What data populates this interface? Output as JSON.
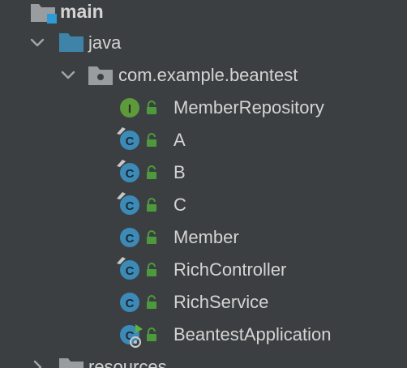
{
  "tree": {
    "main": {
      "label": "main"
    },
    "java": {
      "label": "java"
    },
    "package": {
      "label": "com.example.beantest"
    },
    "classes": [
      {
        "label": "MemberRepository",
        "kind": "interface",
        "letter": "I",
        "icon": "interface-icon",
        "has_tag": false
      },
      {
        "label": "A",
        "kind": "class",
        "letter": "C",
        "icon": "class-icon",
        "has_tag": true
      },
      {
        "label": "B",
        "kind": "class",
        "letter": "C",
        "icon": "class-icon",
        "has_tag": true
      },
      {
        "label": "C",
        "kind": "class",
        "letter": "C",
        "icon": "class-icon",
        "has_tag": true
      },
      {
        "label": "Member",
        "kind": "class",
        "letter": "C",
        "icon": "class-icon",
        "has_tag": false
      },
      {
        "label": "RichController",
        "kind": "class",
        "letter": "C",
        "icon": "class-icon",
        "has_tag": true
      },
      {
        "label": "RichService",
        "kind": "class",
        "letter": "C",
        "icon": "class-icon",
        "has_tag": false
      },
      {
        "label": "BeantestApplication",
        "kind": "spring-boot-app",
        "letter": "C",
        "icon": "spring-boot-class-icon",
        "has_tag": false
      }
    ],
    "resources": {
      "label": "resources"
    }
  },
  "colors": {
    "background": "#3c3f41",
    "text": "#d4d4d4",
    "chevron": "#a4a6a8",
    "folder_blue": "#3f84a8",
    "folder_gray": "#9a9da0",
    "class_circle": "#3b8ab8",
    "interface_circle": "#5c9a3a",
    "lock_green": "#4d9a3d"
  }
}
